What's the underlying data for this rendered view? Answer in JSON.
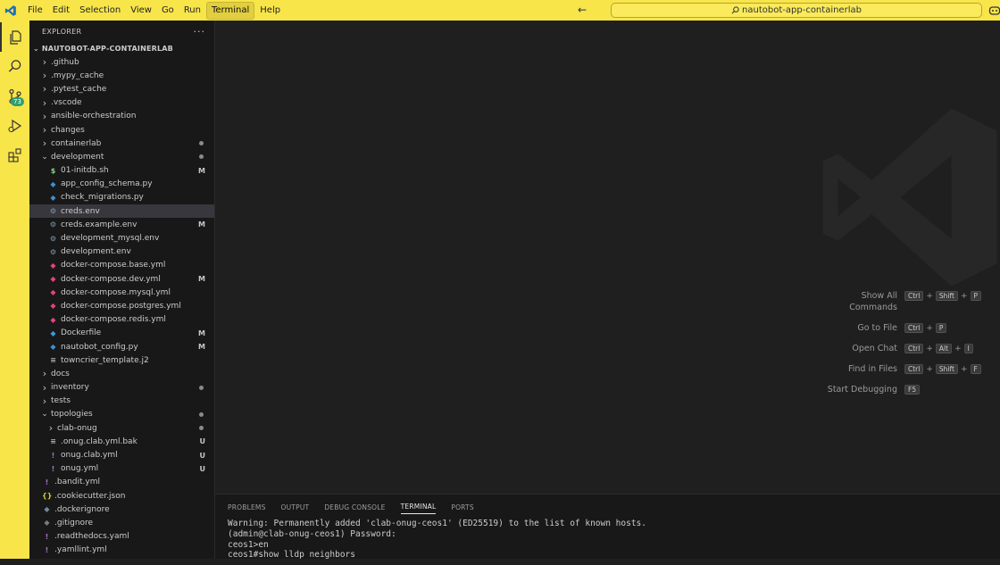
{
  "menu": [
    "File",
    "Edit",
    "Selection",
    "View",
    "Go",
    "Run",
    "Terminal",
    "Help"
  ],
  "active_menu": "Terminal",
  "command_center": "nautobot-app-containerlab",
  "activity": {
    "source_control_badge": "73"
  },
  "explorer": {
    "title": "EXPLORER",
    "more": "···",
    "root": "NAUTOBOT-APP-CONTAINERLAB",
    "items": [
      {
        "name": ".github",
        "kind": "folder",
        "depth": 0,
        "open": false
      },
      {
        "name": ".mypy_cache",
        "kind": "folder",
        "depth": 0,
        "open": false
      },
      {
        "name": ".pytest_cache",
        "kind": "folder",
        "depth": 0,
        "open": false
      },
      {
        "name": ".vscode",
        "kind": "folder",
        "depth": 0,
        "open": false
      },
      {
        "name": "ansible-orchestration",
        "kind": "folder",
        "depth": 0,
        "open": false
      },
      {
        "name": "changes",
        "kind": "folder",
        "depth": 0,
        "open": false
      },
      {
        "name": "containerlab",
        "kind": "folder",
        "depth": 0,
        "open": false,
        "dot": true
      },
      {
        "name": "development",
        "kind": "folder",
        "depth": 0,
        "open": true,
        "dot": true
      },
      {
        "name": "01-initdb.sh",
        "kind": "shell",
        "depth": 1,
        "status": "M"
      },
      {
        "name": "app_config_schema.py",
        "kind": "python",
        "depth": 1
      },
      {
        "name": "check_migrations.py",
        "kind": "python",
        "depth": 1
      },
      {
        "name": "creds.env",
        "kind": "gear",
        "depth": 1,
        "selected": true
      },
      {
        "name": "creds.example.env",
        "kind": "gear",
        "depth": 1,
        "status": "M"
      },
      {
        "name": "development_mysql.env",
        "kind": "gear",
        "depth": 1
      },
      {
        "name": "development.env",
        "kind": "gear",
        "depth": 1
      },
      {
        "name": "docker-compose.base.yml",
        "kind": "compose",
        "depth": 1
      },
      {
        "name": "docker-compose.dev.yml",
        "kind": "compose",
        "depth": 1,
        "status": "M"
      },
      {
        "name": "docker-compose.mysql.yml",
        "kind": "compose",
        "depth": 1
      },
      {
        "name": "docker-compose.postgres.yml",
        "kind": "compose",
        "depth": 1
      },
      {
        "name": "docker-compose.redis.yml",
        "kind": "compose",
        "depth": 1
      },
      {
        "name": "Dockerfile",
        "kind": "docker",
        "depth": 1,
        "status": "M"
      },
      {
        "name": "nautobot_config.py",
        "kind": "python",
        "depth": 1,
        "status": "M"
      },
      {
        "name": "towncrier_template.j2",
        "kind": "lines",
        "depth": 1
      },
      {
        "name": "docs",
        "kind": "folder",
        "depth": 0,
        "open": false
      },
      {
        "name": "inventory",
        "kind": "folder",
        "depth": 0,
        "open": false,
        "dot": true
      },
      {
        "name": "tests",
        "kind": "folder",
        "depth": 0,
        "open": false
      },
      {
        "name": "topologies",
        "kind": "folder",
        "depth": 0,
        "open": true,
        "dot": true
      },
      {
        "name": "clab-onug",
        "kind": "folder",
        "depth": 1,
        "open": false,
        "dot": true
      },
      {
        "name": ".onug.clab.yml.bak",
        "kind": "lines",
        "depth": 1,
        "status": "U"
      },
      {
        "name": "onug.clab.yml",
        "kind": "yaml",
        "depth": 1,
        "status": "U"
      },
      {
        "name": "onug.yml",
        "kind": "yaml",
        "depth": 1,
        "status": "U"
      },
      {
        "name": ".bandit.yml",
        "kind": "yaml",
        "depth": 0
      },
      {
        "name": ".cookiecutter.json",
        "kind": "json",
        "depth": 0
      },
      {
        "name": ".dockerignore",
        "kind": "docker-dim",
        "depth": 0
      },
      {
        "name": ".gitignore",
        "kind": "git",
        "depth": 0
      },
      {
        "name": ".readthedocs.yaml",
        "kind": "yaml",
        "depth": 0
      },
      {
        "name": ".yamllint.yml",
        "kind": "yaml",
        "depth": 0
      }
    ]
  },
  "shortcuts": [
    {
      "label": "Show All Commands",
      "keys": [
        "Ctrl",
        "Shift",
        "P"
      ]
    },
    {
      "label": "Go to File",
      "keys": [
        "Ctrl",
        "P"
      ]
    },
    {
      "label": "Open Chat",
      "keys": [
        "Ctrl",
        "Alt",
        "I"
      ]
    },
    {
      "label": "Find in Files",
      "keys": [
        "Ctrl",
        "Shift",
        "F"
      ]
    },
    {
      "label": "Start Debugging",
      "keys": [
        "F5"
      ]
    }
  ],
  "panel": {
    "tabs": [
      "PROBLEMS",
      "OUTPUT",
      "DEBUG CONSOLE",
      "TERMINAL",
      "PORTS"
    ],
    "active_tab": "TERMINAL",
    "terminal_lines": [
      "Warning: Permanently added 'clab-onug-ceos1' (ED25519) to the list of known hosts.",
      "(admin@clab-onug-ceos1) Password:",
      "ceos1>en",
      "ceos1#show lldp neighbors"
    ]
  },
  "colors": {
    "accent": "#f8e54a",
    "folder": "#c5c5c5",
    "python": "#3d8fd1",
    "shell": "#89d185",
    "compose": "#e8417d",
    "docker": "#3b9ad9",
    "yaml": "#a074c4",
    "json": "#cbcb41"
  }
}
